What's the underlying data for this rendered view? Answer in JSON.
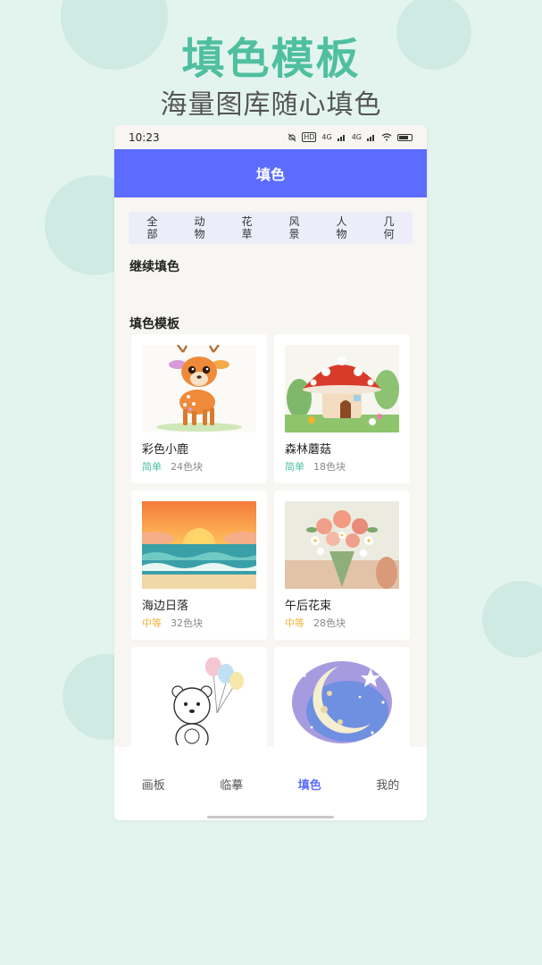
{
  "hero": {
    "title": "填色模板",
    "subtitle": "海量图库随心填色"
  },
  "status": {
    "time": "10:23",
    "net1": "4G",
    "net2": "4G",
    "badge": "HD"
  },
  "appbar": {
    "title": "填色"
  },
  "categories": [
    "全部",
    "动物",
    "花草",
    "风景",
    "人物",
    "几何"
  ],
  "sections": {
    "continue": "继续填色",
    "templates": "填色模板"
  },
  "templates": [
    {
      "title": "彩色小鹿",
      "level": "简单",
      "count": "24色块"
    },
    {
      "title": "森林蘑菇",
      "level": "简单",
      "count": "18色块"
    },
    {
      "title": "海边日落",
      "level": "中等",
      "count": "32色块"
    },
    {
      "title": "午后花束",
      "level": "中等",
      "count": "28色块"
    },
    {
      "title": "",
      "level": "",
      "count": ""
    },
    {
      "title": "",
      "level": "",
      "count": ""
    }
  ],
  "tabs": [
    "画板",
    "临摹",
    "填色",
    "我的"
  ],
  "colors": {
    "accent": "#5b6cff",
    "hero": "#4fbf9f",
    "easy": "#4fbf9f",
    "medium": "#f0b43c",
    "background": "#e3f4ee"
  },
  "icons": [
    "mute-icon",
    "hd-icon",
    "signal-icon",
    "wifi-icon",
    "battery-icon"
  ]
}
